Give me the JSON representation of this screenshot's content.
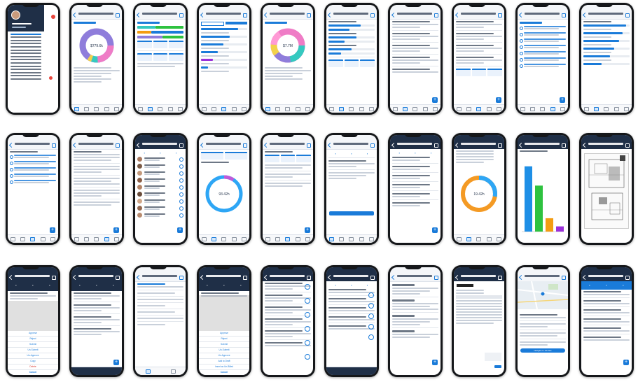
{
  "title": "",
  "colors": {
    "accent": "#1a7bd9",
    "header_dark": "#1f2f47",
    "phone_frame": "#15171a",
    "donut_purple": "#8f7ddb",
    "donut_pink": "#ef7cc6",
    "donut_teal": "#35c9c0",
    "bar_blue": "#1e8fe6",
    "bar_green": "#2ec23f",
    "bar_orange": "#f39c12",
    "bar_purple": "#9b30d9",
    "ring_orange": "#f49a24",
    "delete_red": "#d9352b"
  },
  "phones": {
    "p1": {
      "name": "menu-screen",
      "icon": "hamburger-menu-icon",
      "menu_icon": "user-avatar-icon"
    },
    "p2": {
      "name": "accounts-donut-dashboard",
      "value_label": "$779.6k"
    },
    "p3": {
      "name": "business-client-comparison-bars"
    },
    "p4": {
      "name": "account-balances-list"
    },
    "p5": {
      "name": "expenses-donut-dashboard",
      "value_label": "$7.7M"
    },
    "p6": {
      "name": "team-time-summary-bars"
    },
    "p7": {
      "name": "projects-dashboard-list"
    },
    "p8": {
      "name": "project-invoices-list"
    },
    "p9": {
      "name": "tasks-checklist"
    },
    "p10": {
      "name": "staff-time-bars"
    },
    "p11": {
      "name": "assigned-tasks-checklist"
    },
    "p12": {
      "name": "recent-notes-list"
    },
    "p13": {
      "name": "employees-people-list"
    },
    "p14": {
      "name": "performance-ring",
      "value_label": "93.42h"
    },
    "p15": {
      "name": "resource-assignment-detail"
    },
    "p16": {
      "name": "vendor-detail-form"
    },
    "p17": {
      "name": "projects-kpi-list"
    },
    "p18": {
      "name": "performance-orange-ring",
      "value_label": "19.42h"
    },
    "p19": {
      "name": "billing-bar-chart",
      "bar_values": [
        0.88,
        0.62,
        0.18,
        0.07
      ]
    },
    "p20": {
      "name": "floor-plan-document"
    },
    "p21": {
      "name": "time-entry-actions-sheet",
      "actions": [
        "Approve",
        "Reject",
        "Submit",
        "Un-Submit",
        "Un-Approve",
        "Copy",
        "Delete"
      ],
      "cancel": "Cancel"
    },
    "p22": {
      "name": "expense-entries-list"
    },
    "p23": {
      "name": "new-expense-form"
    },
    "p24": {
      "name": "expense-actions-sheet",
      "actions": [
        "Approve",
        "Reject",
        "Submit",
        "Un-Submit",
        "Un-Approve",
        "Add to Draft",
        "Insert as Un-Billed"
      ],
      "cancel": "Cancel"
    },
    "p25": {
      "name": "timesheet-entries-list"
    },
    "p26": {
      "name": "invoices-entries-list"
    },
    "p27": {
      "name": "calendar-day-list"
    },
    "p28": {
      "name": "invoice-preview-document"
    },
    "p29": {
      "name": "project-map-view",
      "map_button": "Navigate to Job Site"
    },
    "p30": {
      "name": "timesheet-summary-list"
    }
  }
}
